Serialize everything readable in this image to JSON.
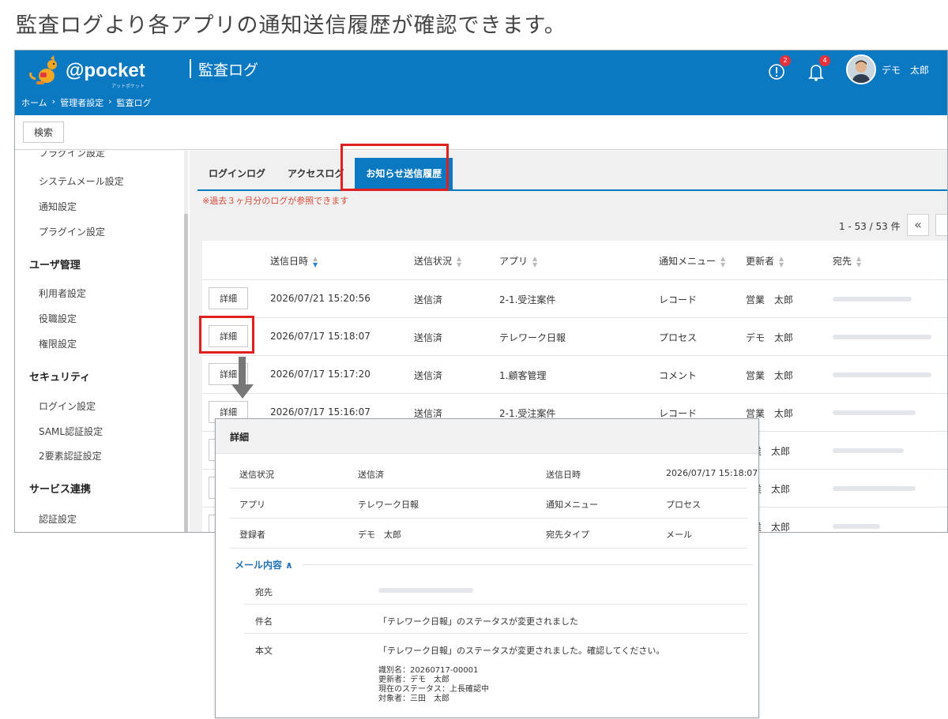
{
  "caption": "監査ログより各アプリの通知送信履歴が確認できます。",
  "header": {
    "logo_text": "@pocket",
    "logo_sub": "アットポケット",
    "title": "監査ログ",
    "breadcrumb": [
      "ホーム",
      "›",
      "管理者設定",
      "›",
      "監査ログ"
    ],
    "info_badge": "2",
    "bell_badge": "4",
    "user_name": "デモ　太郎"
  },
  "search_button": "検索",
  "sidebar": {
    "items": [
      {
        "kind": "item",
        "label": "プラグイン設定"
      },
      {
        "kind": "item",
        "label": "システムメール設定"
      },
      {
        "kind": "item",
        "label": "通知設定"
      },
      {
        "kind": "item",
        "label": "プラグイン設定"
      },
      {
        "kind": "head",
        "label": "ユーザ管理"
      },
      {
        "kind": "item",
        "label": "利用者設定"
      },
      {
        "kind": "item",
        "label": "役職設定"
      },
      {
        "kind": "item",
        "label": "権限設定"
      },
      {
        "kind": "head",
        "label": "セキュリティ"
      },
      {
        "kind": "item",
        "label": "ログイン設定"
      },
      {
        "kind": "item",
        "label": "SAML認証設定"
      },
      {
        "kind": "item",
        "label": "2要素認証設定"
      },
      {
        "kind": "head",
        "label": "サービス連携"
      },
      {
        "kind": "item",
        "label": "認証設定"
      }
    ]
  },
  "tabs": [
    {
      "label": "ログインログ",
      "active": false
    },
    {
      "label": "アクセスログ",
      "active": false
    },
    {
      "label": "お知らせ送信履歴",
      "active": true
    }
  ],
  "notice": "※過去３ヶ月分のログが参照できます",
  "pager": {
    "text": "1 - 53 / 53 件",
    "first_label": "«"
  },
  "table": {
    "columns": [
      "送信日時",
      "送信状況",
      "アプリ",
      "通知メニュー",
      "更新者",
      "宛先"
    ],
    "detail_label": "詳細",
    "rows": [
      {
        "datetime": "2026/07/21 15:20:56",
        "status": "送信済",
        "app": "2-1.受注案件",
        "menu": "レコード",
        "user": "営業　太郎"
      },
      {
        "datetime": "2026/07/17 15:18:07",
        "status": "送信済",
        "app": "テレワーク日報",
        "menu": "プロセス",
        "user": "デモ　太郎"
      },
      {
        "datetime": "2026/07/17 15:17:20",
        "status": "送信済",
        "app": "1.顧客管理",
        "menu": "コメント",
        "user": "営業　太郎"
      },
      {
        "datetime": "2026/07/17 15:16:07",
        "status": "送信済",
        "app": "2-1.受注案件",
        "menu": "レコード",
        "user": "営業　太郎"
      },
      {
        "datetime": "",
        "status": "",
        "app": "",
        "menu": "",
        "user": "業　太郎"
      },
      {
        "datetime": "",
        "status": "",
        "app": "",
        "menu": "",
        "user": "業　太郎"
      },
      {
        "datetime": "",
        "status": "",
        "app": "",
        "menu": "",
        "user": "業　太郎"
      }
    ]
  },
  "modal": {
    "title": "詳細",
    "fields": [
      {
        "label": "送信状況",
        "value": "送信済",
        "label2": "送信日時",
        "value2": "2026/07/17 15:18:07"
      },
      {
        "label": "アプリ",
        "value": "テレワーク日報",
        "label2": "通知メニュー",
        "value2": "プロセス"
      },
      {
        "label": "登録者",
        "value": "デモ　太郎",
        "label2": "宛先タイプ",
        "value2": "メール"
      }
    ],
    "mail_section": "メール内容 ∧",
    "mail": {
      "to_label": "宛先",
      "subject_label": "件名",
      "subject": "「テレワーク日報」のステータスが変更されました",
      "body_label": "本文",
      "body_first": "「テレワーク日報」のステータスが変更されました。確認してください。",
      "body_lines": [
        "識別名：20260717-00001",
        "更新者：デモ　太郎",
        "現在のステータス：上長確認中",
        "対象者：三田　太郎"
      ]
    }
  },
  "colors": {
    "brand": "#0b78c2",
    "highlight": "#e0201e",
    "notice": "#d84a3a",
    "section": "#1f6fb8"
  }
}
